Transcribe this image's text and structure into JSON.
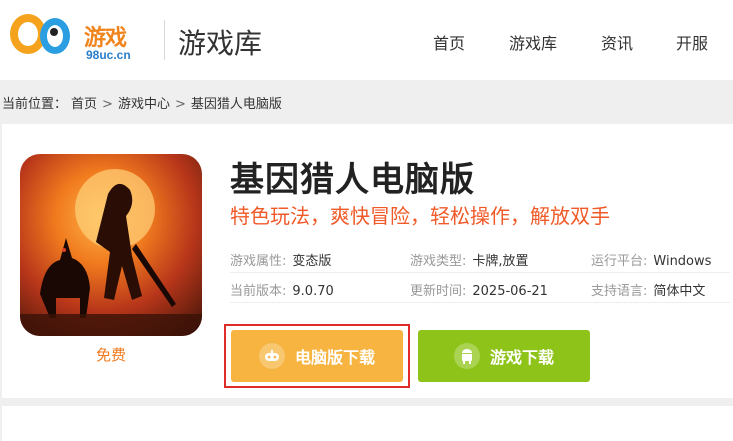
{
  "header": {
    "logo_text": "游戏",
    "logo_url": "98uc.cn",
    "section_title": "游戏库",
    "nav": [
      "首页",
      "游戏库",
      "资讯",
      "开服"
    ]
  },
  "breadcrumb": {
    "prefix": "当前位置：",
    "items": [
      "首页",
      "游戏中心",
      "基因猎人电脑版"
    ],
    "separator": ">"
  },
  "game": {
    "title": "基因猎人电脑版",
    "subtitle": "特色玩法，爽快冒险，轻松操作，解放双手",
    "price": "免费",
    "attributes": [
      {
        "label": "游戏属性:",
        "value": "变态版"
      },
      {
        "label": "游戏类型:",
        "value": "卡牌,放置"
      },
      {
        "label": "运行平台:",
        "value": "Windows"
      },
      {
        "label": "当前版本:",
        "value": "9.0.70"
      },
      {
        "label": "更新时间:",
        "value": "2025-06-21"
      },
      {
        "label": "支持语言:",
        "value": "简体中文"
      }
    ]
  },
  "buttons": {
    "pc_download": "电脑版下载",
    "game_download": "游戏下载"
  },
  "colors": {
    "accent_orange": "#f05a28",
    "pc_button": "#f7b441",
    "game_button": "#8ec419",
    "highlight_border": "#e02b2b"
  }
}
